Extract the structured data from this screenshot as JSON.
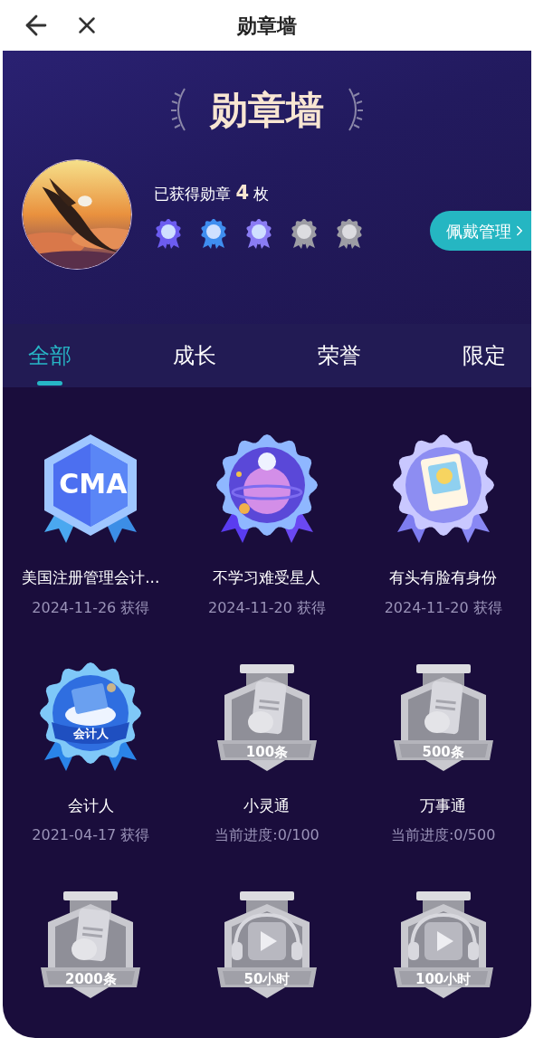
{
  "nav": {
    "title": "勋章墙"
  },
  "header": {
    "title": "勋章墙",
    "earned_prefix": "已获得勋章",
    "earned_count": "4",
    "earned_suffix": "枚",
    "manage_button": "佩戴管理",
    "worn_badges": [
      {
        "earned": true
      },
      {
        "earned": true
      },
      {
        "earned": true
      },
      {
        "earned": false
      },
      {
        "earned": false
      }
    ]
  },
  "tabs": [
    {
      "label": "全部",
      "selected": true
    },
    {
      "label": "成长",
      "selected": false
    },
    {
      "label": "荣誉",
      "selected": false
    },
    {
      "label": "限定",
      "selected": false
    }
  ],
  "badges": [
    {
      "kind": "hex",
      "emblem": "CMA",
      "name": "美国注册管理会计...",
      "note": "2024-11-26 获得"
    },
    {
      "kind": "planet",
      "name": "不学习难受星人",
      "note": "2024-11-20 获得"
    },
    {
      "kind": "idcard",
      "name": "有头有脸有身份",
      "note": "2024-11-20 获得"
    },
    {
      "kind": "calculator",
      "ribbon": "会计人",
      "name": "会计人",
      "note": "2021-04-17 获得"
    },
    {
      "kind": "news",
      "ribbon": "100条",
      "name": "小灵通",
      "note": "当前进度:0/100"
    },
    {
      "kind": "news",
      "ribbon": "500条",
      "name": "万事通",
      "note": "当前进度:0/500"
    },
    {
      "kind": "news",
      "ribbon": "2000条"
    },
    {
      "kind": "play",
      "ribbon": "50小时"
    },
    {
      "kind": "play",
      "ribbon": "100小时"
    }
  ]
}
